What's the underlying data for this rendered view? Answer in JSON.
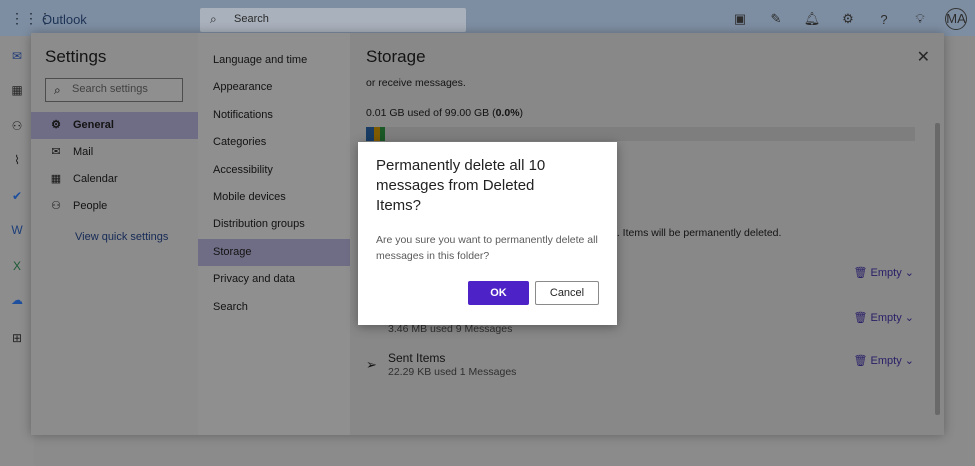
{
  "topbar": {
    "brand": "Outlook",
    "search_placeholder": "Search",
    "avatar_initials": "MA",
    "icons": [
      "teams-icon",
      "tasks-icon",
      "bell-icon",
      "gear-icon",
      "help-icon",
      "lightbulb-icon"
    ]
  },
  "rail": {
    "icons": [
      "mail-icon",
      "calendar-icon",
      "people-icon",
      "attachment-icon",
      "todo-icon",
      "word-icon",
      "excel-icon",
      "onedrive-icon",
      "apps-icon"
    ]
  },
  "settings": {
    "title": "Settings",
    "search_placeholder": "Search settings",
    "categories": [
      {
        "label": "General",
        "icon": "gear-icon",
        "active": true
      },
      {
        "label": "Mail",
        "icon": "mail-icon",
        "active": false
      },
      {
        "label": "Calendar",
        "icon": "calendar-icon",
        "active": false
      },
      {
        "label": "People",
        "icon": "people-icon",
        "active": false
      }
    ],
    "quick_settings_link": "View quick settings",
    "subnav": [
      "Language and time",
      "Appearance",
      "Notifications",
      "Categories",
      "Accessibility",
      "Mobile devices",
      "Distribution groups",
      "Storage",
      "Privacy and data",
      "Search"
    ],
    "subnav_active": "Storage"
  },
  "storage": {
    "title": "Storage",
    "top_text": "or receive messages.",
    "usage_prefix": "0.01 GB used of 99.00 GB (",
    "usage_percent": "0.0%",
    "usage_suffix": ")",
    "bar_colors": [
      "#2b6cb0",
      "#e3a300",
      "#2f9e44"
    ],
    "partial_text": "e. Items will be permanently deleted.",
    "folders": [
      {
        "name": "",
        "meta": "",
        "action": "Empty"
      },
      {
        "name": "",
        "meta": "3.46 MB used  9 Messages",
        "action": "Empty"
      },
      {
        "name": "Sent Items",
        "meta": "22.29 KB used  1 Messages",
        "action": "Empty"
      }
    ]
  },
  "dialog": {
    "title": "Permanently delete all 10 messages from Deleted Items?",
    "message": "Are you sure you want to permanently delete all messages in this folder?",
    "ok_label": "OK",
    "cancel_label": "Cancel"
  },
  "colors": {
    "accent": "#4d23c7",
    "selection": "#c7c2ed",
    "link": "#2a4d9a"
  }
}
